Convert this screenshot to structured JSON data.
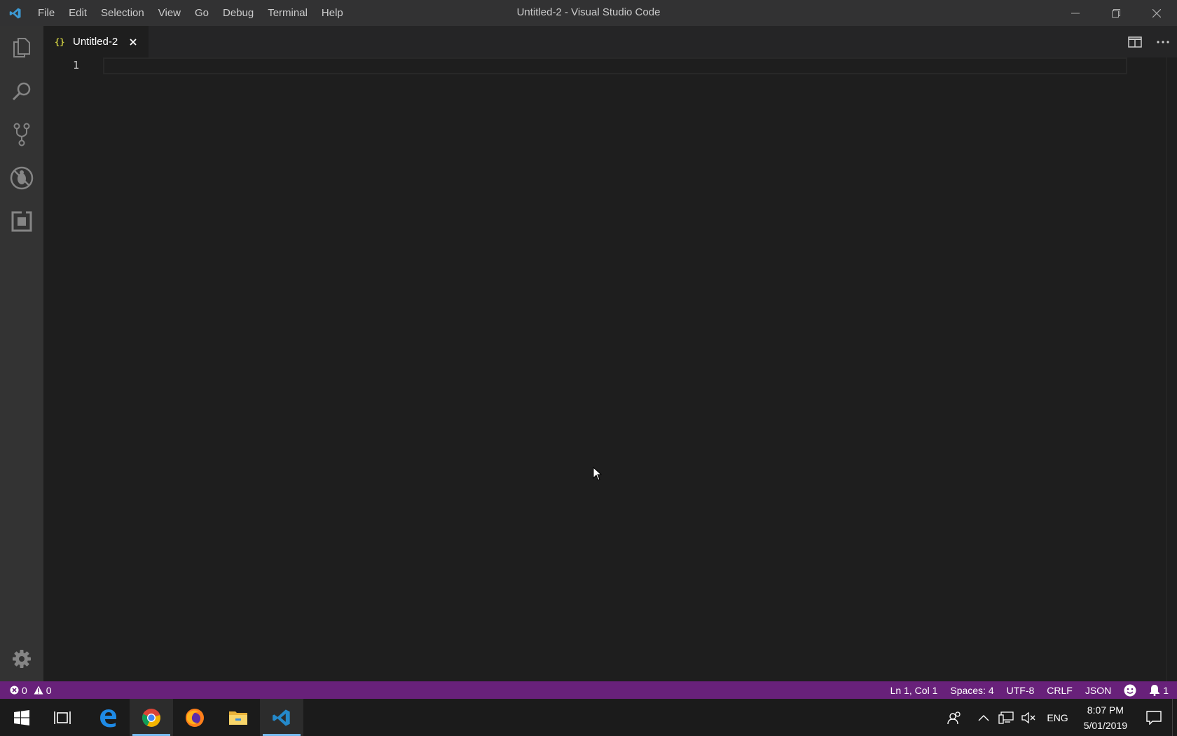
{
  "window": {
    "title": "Untitled-2 - Visual Studio Code"
  },
  "menubar": {
    "items": [
      "File",
      "Edit",
      "Selection",
      "View",
      "Go",
      "Debug",
      "Terminal",
      "Help"
    ]
  },
  "activitybar": {
    "items": [
      "files-icon",
      "search-icon",
      "source-control-icon",
      "debug-icon",
      "extensions-icon"
    ],
    "bottom": "gear-icon"
  },
  "tabs": [
    {
      "label": "Untitled-2",
      "icon_glyph": "{}"
    }
  ],
  "editor": {
    "line_numbers": [
      "1"
    ]
  },
  "statusbar": {
    "errors": "0",
    "warnings": "0",
    "position": "Ln 1, Col 1",
    "spaces": "Spaces: 4",
    "encoding": "UTF-8",
    "eol": "CRLF",
    "language": "JSON",
    "notifications": "1"
  },
  "taskbar": {
    "apps": [
      "windows-start-icon",
      "task-view-icon",
      "edge-icon",
      "chrome-icon",
      "firefox-icon",
      "file-explorer-icon",
      "vscode-icon"
    ],
    "language": "ENG",
    "time": "8:07 PM",
    "date": "5/01/2019"
  },
  "colors": {
    "statusbar": "#68217a",
    "accent": "#007acc",
    "json_icon": "#cbcb41"
  }
}
